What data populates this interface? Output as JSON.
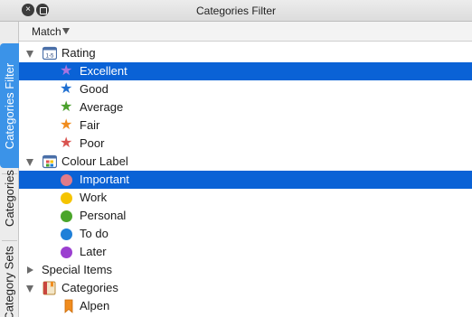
{
  "window": {
    "title": "Categories Filter",
    "close_glyph": "×"
  },
  "side_tabs": [
    {
      "label": "Categories Filter",
      "active": true
    },
    {
      "label": "Categories",
      "active": false
    },
    {
      "label": "Category Sets",
      "active": false
    }
  ],
  "toolbar": {
    "match_label": "Match"
  },
  "tree": {
    "rating": {
      "label": "Rating",
      "icon": "rating-1-5-icon",
      "icon_text": "1-5",
      "items": [
        {
          "label": "Excellent",
          "icon": "star-icon",
          "color": "#9b59d0",
          "selected": true
        },
        {
          "label": "Good",
          "icon": "star-icon",
          "color": "#1f6fd1",
          "selected": false
        },
        {
          "label": "Average",
          "icon": "star-icon",
          "color": "#4aa02c",
          "selected": false
        },
        {
          "label": "Fair",
          "icon": "star-icon",
          "color": "#f08c1e",
          "selected": false
        },
        {
          "label": "Poor",
          "icon": "star-icon",
          "color": "#d9534f",
          "selected": false
        }
      ]
    },
    "colour_label": {
      "label": "Colour Label",
      "icon": "colour-palette-icon",
      "items": [
        {
          "label": "Important",
          "icon": "circle-icon",
          "color": "#e07b8a",
          "selected": true
        },
        {
          "label": "Work",
          "icon": "circle-icon",
          "color": "#f5c400",
          "selected": false
        },
        {
          "label": "Personal",
          "icon": "circle-icon",
          "color": "#4aa52a",
          "selected": false
        },
        {
          "label": "To do",
          "icon": "circle-icon",
          "color": "#1f80d8",
          "selected": false
        },
        {
          "label": "Later",
          "icon": "circle-icon",
          "color": "#9b3fd0",
          "selected": false
        }
      ]
    },
    "special_items": {
      "label": "Special Items"
    },
    "categories": {
      "label": "Categories",
      "icon": "category-book-icon",
      "items": [
        {
          "label": "Alpen",
          "icon": "bookmark-icon",
          "color": "#f08c1e"
        }
      ]
    }
  }
}
